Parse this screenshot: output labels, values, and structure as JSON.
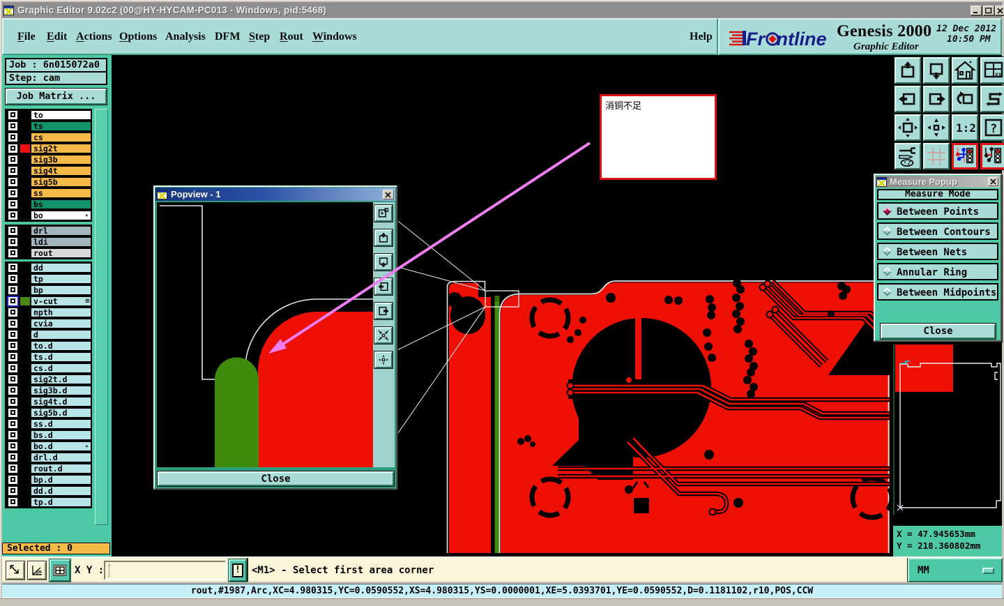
{
  "window": {
    "title": "Graphic Editor 9.02c2 (00@HY-HYCAM-PC013 - Windows, pid:5468)",
    "controls": {
      "minimize": "minimize",
      "maximize": "maximize",
      "close": "close"
    }
  },
  "menu": {
    "items": [
      {
        "label": "File",
        "underline": 0
      },
      {
        "label": "Edit",
        "underline": 0
      },
      {
        "label": "Actions",
        "underline": 0
      },
      {
        "label": "Options",
        "underline": 0
      },
      {
        "label": "Analysis",
        "underline": -1
      },
      {
        "label": "DFM",
        "underline": -1
      },
      {
        "label": "Step",
        "underline": 0
      },
      {
        "label": "Rout",
        "underline": 0
      },
      {
        "label": "Windows",
        "underline": 0
      },
      {
        "label": "Help",
        "underline": -1
      }
    ]
  },
  "brand": {
    "logo_text": "Frontline",
    "product": "Genesis 2000",
    "date": "12 Dec 2012",
    "time": "10:50 PM",
    "subtitle": "Graphic Editor"
  },
  "sidebar": {
    "job_label": "Job : 6n015072a0",
    "step_label": "Step: cam",
    "job_matrix_label": "Job Matrix ...",
    "selected_label": "Selected : 0",
    "layer_groups": [
      {
        "layers": [
          {
            "name": "to",
            "bg": "#ffffff"
          },
          {
            "name": "ts",
            "bg": "#12926b"
          },
          {
            "name": "cs",
            "bg": "#f5ba47"
          },
          {
            "name": "sig2t",
            "bg": "#f5ba47",
            "swatch": "#ee1010"
          },
          {
            "name": "sig3b",
            "bg": "#f5ba47"
          },
          {
            "name": "sig4t",
            "bg": "#f5ba47"
          },
          {
            "name": "sig5b",
            "bg": "#f5ba47"
          },
          {
            "name": "ss",
            "bg": "#f5ba47"
          },
          {
            "name": "bs",
            "bg": "#12926b"
          },
          {
            "name": "bo",
            "bg": "#ffffff",
            "glyph": "pen"
          }
        ]
      },
      {
        "layers": [
          {
            "name": "drl",
            "bg": "#a3b5bd"
          },
          {
            "name": "ldi",
            "bg": "#a3b5bd"
          },
          {
            "name": "rout",
            "bg": "#d9d9d9"
          }
        ]
      },
      {
        "layers": [
          {
            "name": "dd",
            "bg": "#b7e2e6"
          },
          {
            "name": "tp",
            "bg": "#b7e2e6"
          },
          {
            "name": "bp",
            "bg": "#b7e2e6"
          },
          {
            "name": "v-cut",
            "bg": "#b7e2e6",
            "swatch": "#4a8a14",
            "check": "blue",
            "glyph": "grid"
          },
          {
            "name": "npth",
            "bg": "#b7e2e6"
          },
          {
            "name": "cvia",
            "bg": "#b7e2e6"
          },
          {
            "name": "d",
            "bg": "#b7e2e6"
          },
          {
            "name": "to.d",
            "bg": "#b7e2e6"
          },
          {
            "name": "ts.d",
            "bg": "#b7e2e6"
          },
          {
            "name": "cs.d",
            "bg": "#b7e2e6"
          },
          {
            "name": "sig2t.d",
            "bg": "#b7e2e6"
          },
          {
            "name": "sig3b.d",
            "bg": "#b7e2e6"
          },
          {
            "name": "sig4t.d",
            "bg": "#b7e2e6"
          },
          {
            "name": "sig5b.d",
            "bg": "#b7e2e6"
          },
          {
            "name": "ss.d",
            "bg": "#b7e2e6"
          },
          {
            "name": "bs.d",
            "bg": "#b7e2e6"
          },
          {
            "name": "bo.d",
            "bg": "#b7e2e6",
            "glyph": "pen"
          },
          {
            "name": "drl.d",
            "bg": "#b7e2e6"
          },
          {
            "name": "rout.d",
            "bg": "#b7e2e6"
          },
          {
            "name": "bp.d",
            "bg": "#b7e2e6"
          },
          {
            "name": "dd.d",
            "bg": "#b7e2e6"
          },
          {
            "name": "tp.d",
            "bg": "#b7e2e6"
          }
        ]
      }
    ]
  },
  "toolbar": {
    "buttons": [
      {
        "icon": "zoom-window-up"
      },
      {
        "icon": "zoom-window-down"
      },
      {
        "icon": "home-view"
      },
      {
        "icon": "window-xy"
      },
      {
        "icon": "pan-left"
      },
      {
        "icon": "pan-right"
      },
      {
        "icon": "redraw"
      },
      {
        "icon": "route-s"
      },
      {
        "icon": "zoom-extents"
      },
      {
        "icon": "pan-center"
      },
      {
        "icon": "zoom-1-2",
        "text": "1:2"
      },
      {
        "icon": "help-q",
        "text": "?"
      },
      {
        "icon": "setup-tools"
      },
      {
        "icon": "grid"
      },
      {
        "icon": "netlist-cross",
        "red_border": true
      },
      {
        "icon": "netlist-compare",
        "red_border": true
      }
    ]
  },
  "annotation": {
    "text": "消铜不足"
  },
  "popview": {
    "title": "Popview - 1",
    "close_button": "Close",
    "buttons": [
      {
        "icon": "pv-window"
      },
      {
        "icon": "pv-up"
      },
      {
        "icon": "pv-down"
      },
      {
        "icon": "pv-left"
      },
      {
        "icon": "pv-right"
      },
      {
        "icon": "pv-in"
      },
      {
        "icon": "pv-out"
      }
    ]
  },
  "measure": {
    "title": "Measure Popup",
    "header": "Measure Mode",
    "options": [
      {
        "label": "Between Points",
        "selected": true
      },
      {
        "label": "Between Contours",
        "selected": false
      },
      {
        "label": "Between Nets",
        "selected": false
      },
      {
        "label": "Annular Ring",
        "selected": false
      },
      {
        "label": "Between Midpoints",
        "selected": false
      }
    ],
    "close_button": "Close"
  },
  "overview": {
    "x_readout": "X = 47.945653mm",
    "y_readout": "Y = 218.360802mm"
  },
  "statusbar": {
    "xy_label": "X Y :",
    "xy_value": "",
    "alert_label": "!",
    "prompt": "<M1> - Select first area corner",
    "units": "MM"
  },
  "message_line": "rout,#1987,Arc,XC=4.980315,YC=0.0590552,XS=4.980315,YS=0.0000001,XE=5.0393701,YE=0.0590552,D=0.1181102,r10,POS,CCW",
  "colors": {
    "teal-light": "#a9dcd7",
    "teal-mid": "#4dc9a6",
    "orange": "#f5ba47",
    "cream": "#f8f5d8",
    "cyanbar": "#c6eff8",
    "pcb-red": "#ee0f05",
    "pcb-green": "#3e8b0e",
    "magenta": "#ee7ef2"
  }
}
